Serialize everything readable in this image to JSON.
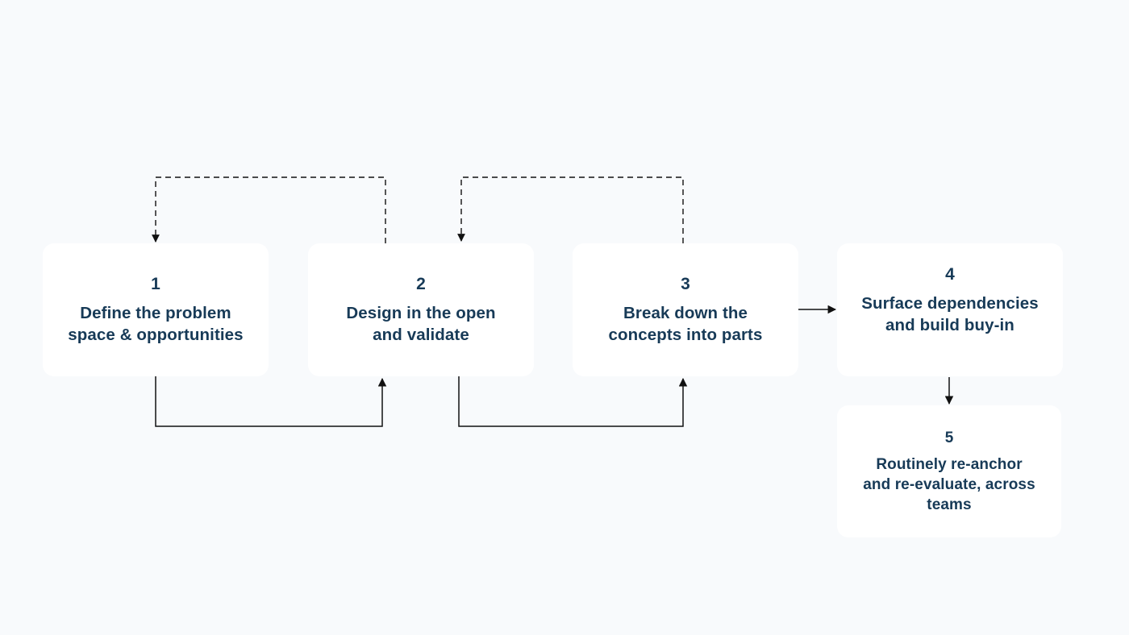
{
  "diagram": {
    "type": "process-flow",
    "colors": {
      "background": "#f8fafc",
      "box": "#ffffff",
      "text": "#173a57",
      "connector": "#111111"
    },
    "steps": [
      {
        "number": "1",
        "label": "Define the problem space & opportunities",
        "lines": [
          "Define the problem",
          "space & opportunities"
        ]
      },
      {
        "number": "2",
        "label": "Design in the open and validate",
        "lines": [
          "Design in the open",
          "and validate"
        ]
      },
      {
        "number": "3",
        "label": "Break down the concepts into parts",
        "lines": [
          "Break down the",
          "concepts into parts"
        ]
      },
      {
        "number": "4",
        "label": "Surface dependencies and build buy-in",
        "lines": [
          "Surface dependencies",
          "and build buy-in"
        ]
      },
      {
        "number": "5",
        "label": "Routinely re-anchor and re-evaluate, across teams",
        "lines": [
          "Routinely re-anchor",
          "and re-evaluate, across",
          "teams"
        ]
      }
    ],
    "edges": [
      {
        "from": "1",
        "to": "2",
        "style": "solid",
        "route": "below"
      },
      {
        "from": "2",
        "to": "1",
        "style": "dashed",
        "route": "above"
      },
      {
        "from": "2",
        "to": "3",
        "style": "solid",
        "route": "below"
      },
      {
        "from": "3",
        "to": "2",
        "style": "dashed",
        "route": "above"
      },
      {
        "from": "3",
        "to": "4",
        "style": "solid",
        "route": "direct"
      },
      {
        "from": "4",
        "to": "5",
        "style": "solid",
        "route": "direct"
      }
    ]
  }
}
